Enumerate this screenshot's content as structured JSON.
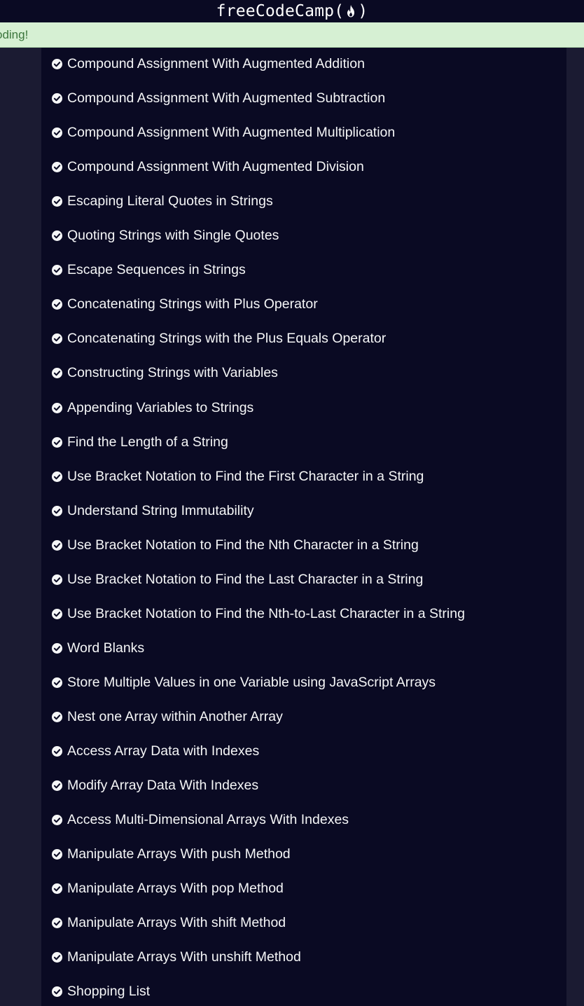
{
  "header": {
    "brand": {
      "name": "freeCodeCamp",
      "open_paren": "(",
      "close_paren": ")",
      "icon": "flame-icon"
    }
  },
  "banner": {
    "text": "oding!"
  },
  "lessons": {
    "status_icon": "check-circle-icon",
    "items": [
      "Compound Assignment With Augmented Addition",
      "Compound Assignment With Augmented Subtraction",
      "Compound Assignment With Augmented Multiplication",
      "Compound Assignment With Augmented Division",
      "Escaping Literal Quotes in Strings",
      "Quoting Strings with Single Quotes",
      "Escape Sequences in Strings",
      "Concatenating Strings with Plus Operator",
      "Concatenating Strings with the Plus Equals Operator",
      "Constructing Strings with Variables",
      "Appending Variables to Strings",
      "Find the Length of a String",
      "Use Bracket Notation to Find the First Character in a String",
      "Understand String Immutability",
      "Use Bracket Notation to Find the Nth Character in a String",
      "Use Bracket Notation to Find the Last Character in a String",
      "Use Bracket Notation to Find the Nth-to-Last Character in a String",
      "Word Blanks",
      "Store Multiple Values in one Variable using JavaScript Arrays",
      "Nest one Array within Another Array",
      "Access Array Data with Indexes",
      "Modify Array Data With Indexes",
      "Access Multi-Dimensional Arrays With Indexes",
      "Manipulate Arrays With push Method",
      "Manipulate Arrays With pop Method",
      "Manipulate Arrays With shift Method",
      "Manipulate Arrays With unshift Method",
      "Shopping List"
    ]
  },
  "colors": {
    "nav_background": "#0a0a23",
    "page_background": "#1b1b32",
    "banner_background": "#d6f0d3",
    "banner_text": "#3c763d",
    "list_text": "#f5f6f7"
  }
}
